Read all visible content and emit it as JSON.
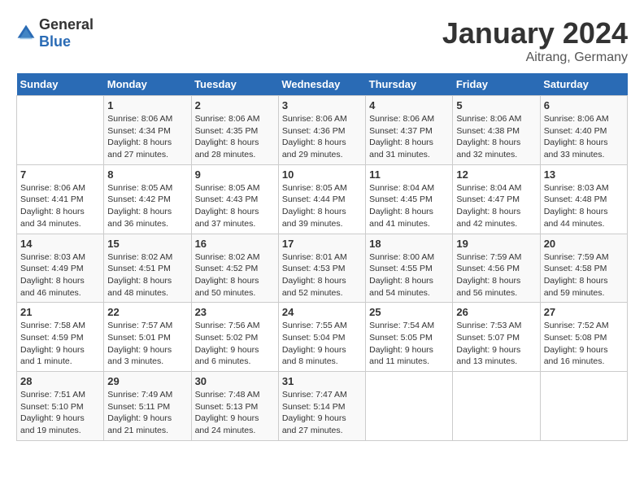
{
  "logo": {
    "general": "General",
    "blue": "Blue"
  },
  "header": {
    "month": "January 2024",
    "location": "Aitrang, Germany"
  },
  "weekdays": [
    "Sunday",
    "Monday",
    "Tuesday",
    "Wednesday",
    "Thursday",
    "Friday",
    "Saturday"
  ],
  "weeks": [
    [
      {
        "day": "",
        "info": ""
      },
      {
        "day": "1",
        "info": "Sunrise: 8:06 AM\nSunset: 4:34 PM\nDaylight: 8 hours\nand 27 minutes."
      },
      {
        "day": "2",
        "info": "Sunrise: 8:06 AM\nSunset: 4:35 PM\nDaylight: 8 hours\nand 28 minutes."
      },
      {
        "day": "3",
        "info": "Sunrise: 8:06 AM\nSunset: 4:36 PM\nDaylight: 8 hours\nand 29 minutes."
      },
      {
        "day": "4",
        "info": "Sunrise: 8:06 AM\nSunset: 4:37 PM\nDaylight: 8 hours\nand 31 minutes."
      },
      {
        "day": "5",
        "info": "Sunrise: 8:06 AM\nSunset: 4:38 PM\nDaylight: 8 hours\nand 32 minutes."
      },
      {
        "day": "6",
        "info": "Sunrise: 8:06 AM\nSunset: 4:40 PM\nDaylight: 8 hours\nand 33 minutes."
      }
    ],
    [
      {
        "day": "7",
        "info": "Sunrise: 8:06 AM\nSunset: 4:41 PM\nDaylight: 8 hours\nand 34 minutes."
      },
      {
        "day": "8",
        "info": "Sunrise: 8:05 AM\nSunset: 4:42 PM\nDaylight: 8 hours\nand 36 minutes."
      },
      {
        "day": "9",
        "info": "Sunrise: 8:05 AM\nSunset: 4:43 PM\nDaylight: 8 hours\nand 37 minutes."
      },
      {
        "day": "10",
        "info": "Sunrise: 8:05 AM\nSunset: 4:44 PM\nDaylight: 8 hours\nand 39 minutes."
      },
      {
        "day": "11",
        "info": "Sunrise: 8:04 AM\nSunset: 4:45 PM\nDaylight: 8 hours\nand 41 minutes."
      },
      {
        "day": "12",
        "info": "Sunrise: 8:04 AM\nSunset: 4:47 PM\nDaylight: 8 hours\nand 42 minutes."
      },
      {
        "day": "13",
        "info": "Sunrise: 8:03 AM\nSunset: 4:48 PM\nDaylight: 8 hours\nand 44 minutes."
      }
    ],
    [
      {
        "day": "14",
        "info": "Sunrise: 8:03 AM\nSunset: 4:49 PM\nDaylight: 8 hours\nand 46 minutes."
      },
      {
        "day": "15",
        "info": "Sunrise: 8:02 AM\nSunset: 4:51 PM\nDaylight: 8 hours\nand 48 minutes."
      },
      {
        "day": "16",
        "info": "Sunrise: 8:02 AM\nSunset: 4:52 PM\nDaylight: 8 hours\nand 50 minutes."
      },
      {
        "day": "17",
        "info": "Sunrise: 8:01 AM\nSunset: 4:53 PM\nDaylight: 8 hours\nand 52 minutes."
      },
      {
        "day": "18",
        "info": "Sunrise: 8:00 AM\nSunset: 4:55 PM\nDaylight: 8 hours\nand 54 minutes."
      },
      {
        "day": "19",
        "info": "Sunrise: 7:59 AM\nSunset: 4:56 PM\nDaylight: 8 hours\nand 56 minutes."
      },
      {
        "day": "20",
        "info": "Sunrise: 7:59 AM\nSunset: 4:58 PM\nDaylight: 8 hours\nand 59 minutes."
      }
    ],
    [
      {
        "day": "21",
        "info": "Sunrise: 7:58 AM\nSunset: 4:59 PM\nDaylight: 9 hours\nand 1 minute."
      },
      {
        "day": "22",
        "info": "Sunrise: 7:57 AM\nSunset: 5:01 PM\nDaylight: 9 hours\nand 3 minutes."
      },
      {
        "day": "23",
        "info": "Sunrise: 7:56 AM\nSunset: 5:02 PM\nDaylight: 9 hours\nand 6 minutes."
      },
      {
        "day": "24",
        "info": "Sunrise: 7:55 AM\nSunset: 5:04 PM\nDaylight: 9 hours\nand 8 minutes."
      },
      {
        "day": "25",
        "info": "Sunrise: 7:54 AM\nSunset: 5:05 PM\nDaylight: 9 hours\nand 11 minutes."
      },
      {
        "day": "26",
        "info": "Sunrise: 7:53 AM\nSunset: 5:07 PM\nDaylight: 9 hours\nand 13 minutes."
      },
      {
        "day": "27",
        "info": "Sunrise: 7:52 AM\nSunset: 5:08 PM\nDaylight: 9 hours\nand 16 minutes."
      }
    ],
    [
      {
        "day": "28",
        "info": "Sunrise: 7:51 AM\nSunset: 5:10 PM\nDaylight: 9 hours\nand 19 minutes."
      },
      {
        "day": "29",
        "info": "Sunrise: 7:49 AM\nSunset: 5:11 PM\nDaylight: 9 hours\nand 21 minutes."
      },
      {
        "day": "30",
        "info": "Sunrise: 7:48 AM\nSunset: 5:13 PM\nDaylight: 9 hours\nand 24 minutes."
      },
      {
        "day": "31",
        "info": "Sunrise: 7:47 AM\nSunset: 5:14 PM\nDaylight: 9 hours\nand 27 minutes."
      },
      {
        "day": "",
        "info": ""
      },
      {
        "day": "",
        "info": ""
      },
      {
        "day": "",
        "info": ""
      }
    ]
  ]
}
